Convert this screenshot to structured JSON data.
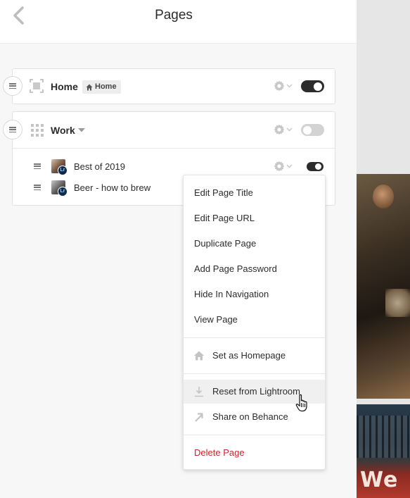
{
  "header": {
    "title": "Pages",
    "back_icon": "chevron-left-icon"
  },
  "pages": {
    "home": {
      "title": "Home",
      "badge": "Home",
      "badge_icon": "home-icon",
      "page_icon": "frame-icon",
      "enabled": true
    },
    "work": {
      "title": "Work",
      "page_icon": "grid-icon",
      "enabled": false,
      "children": [
        {
          "title": "Best of 2019",
          "badge": "Lr",
          "enabled": true
        },
        {
          "title": "Beer - how to brew",
          "badge": "Lr"
        }
      ]
    }
  },
  "menu": {
    "items_top": [
      "Edit Page Title",
      "Edit Page URL",
      "Duplicate Page",
      "Add Page Password",
      "Hide In Navigation",
      "View Page"
    ],
    "set_homepage": "Set as Homepage",
    "reset_lightroom": "Reset from Lightroom",
    "share_behance": "Share on Behance",
    "delete": "Delete Page"
  },
  "background_photo_text": "We",
  "colors": {
    "toggle_on": "#2c2c2c",
    "toggle_off": "#d3d3d3",
    "danger": "#c9252d",
    "lightroom_badge": "#0f2a4a"
  }
}
